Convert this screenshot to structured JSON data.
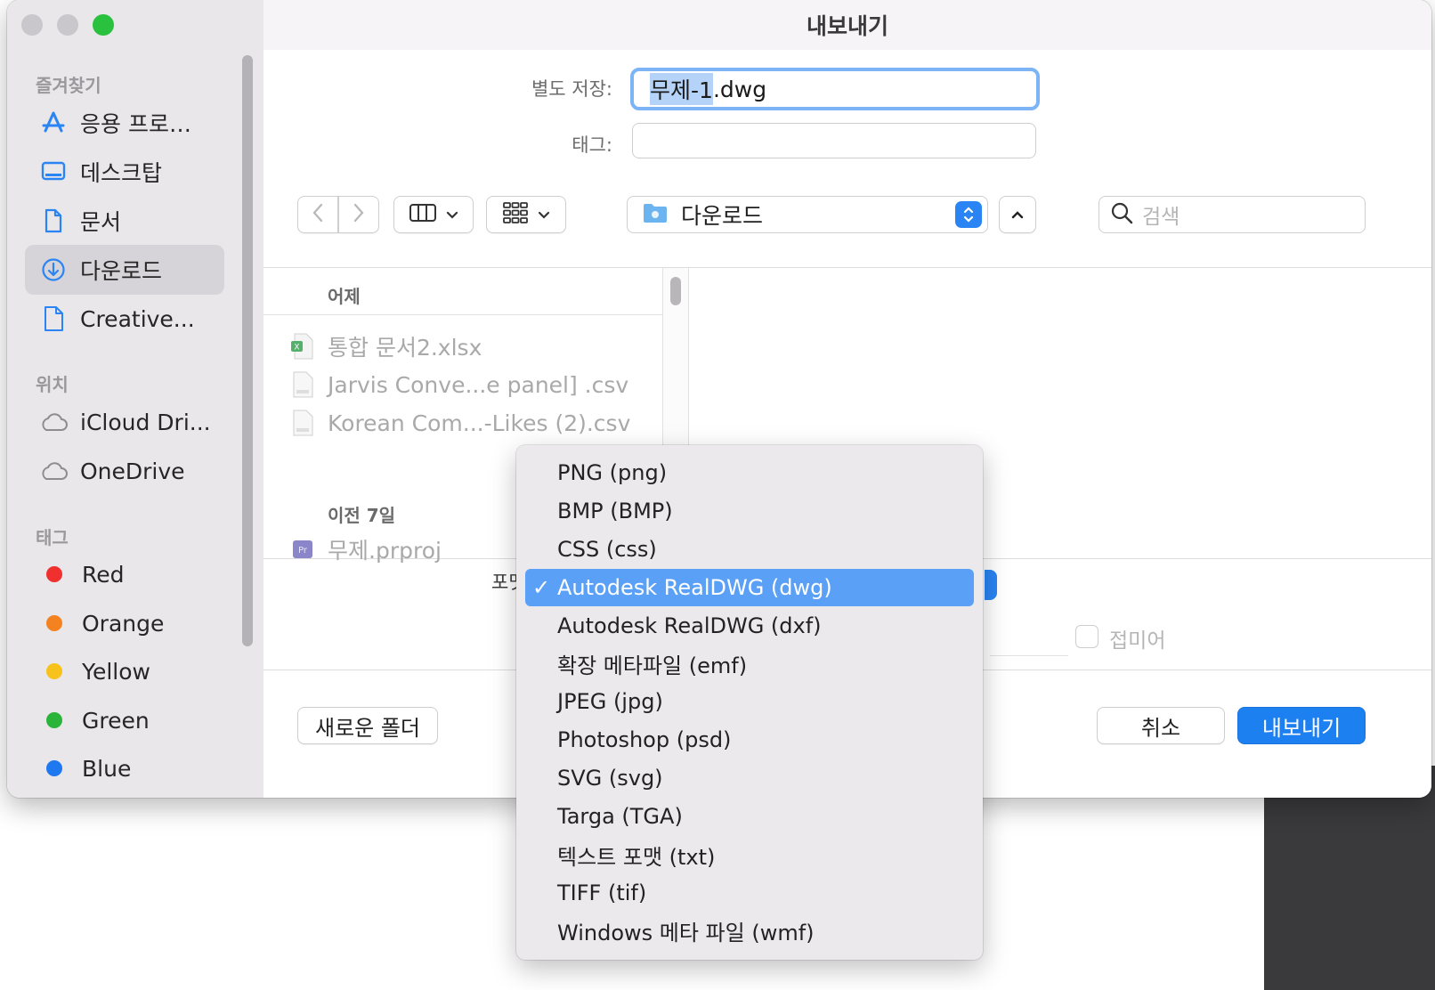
{
  "window": {
    "title": "내보내기"
  },
  "sidebar": {
    "favorites_header": "즐겨찾기",
    "favorites": [
      {
        "label": "응용 프로…",
        "icon": "app-store-icon"
      },
      {
        "label": "데스크탑",
        "icon": "desktop-icon"
      },
      {
        "label": "문서",
        "icon": "document-icon"
      },
      {
        "label": "다운로드",
        "icon": "download-icon",
        "selected": true
      },
      {
        "label": "Creative...",
        "icon": "file-icon"
      }
    ],
    "locations_header": "위치",
    "locations": [
      {
        "label": "iCloud Dri...",
        "icon": "cloud-icon"
      },
      {
        "label": "OneDrive",
        "icon": "cloud-icon"
      }
    ],
    "tags_header": "태그",
    "tags": [
      {
        "label": "Red",
        "color": "#f0302e"
      },
      {
        "label": "Orange",
        "color": "#f58220"
      },
      {
        "label": "Yellow",
        "color": "#f8c21c"
      },
      {
        "label": "Green",
        "color": "#2ab53a"
      },
      {
        "label": "Blue",
        "color": "#1e78f0"
      }
    ]
  },
  "form": {
    "save_as_label": "별도 저장:",
    "filename_selected": "무제-1",
    "filename_ext": ".dwg",
    "tags_label": "태그:",
    "tags_value": ""
  },
  "toolbar": {
    "location": "다운로드",
    "search_placeholder": "검색"
  },
  "browser": {
    "group1_header": "어제",
    "group1_files": [
      {
        "name": "통합 문서2.xlsx",
        "type": "xlsx"
      },
      {
        "name": "Jarvis Conve...e panel] .csv",
        "type": "csv"
      },
      {
        "name": "Korean Com...-Likes (2).csv",
        "type": "csv"
      }
    ],
    "group2_header": "이전 7일",
    "group2_files": [
      {
        "name": "무제.prproj",
        "type": "prproj"
      }
    ]
  },
  "options": {
    "format_label": "포맷:",
    "hide_extension_label": "접미어"
  },
  "buttons": {
    "new_folder": "새로운 폴더",
    "cancel": "취소",
    "export": "내보내기"
  },
  "format_menu": {
    "items": [
      "PNG (png)",
      "BMP (BMP)",
      "CSS (css)",
      "Autodesk RealDWG (dwg)",
      "Autodesk RealDWG (dxf)",
      "확장 메타파일 (emf)",
      "JPEG (jpg)",
      "Photoshop (psd)",
      "SVG (svg)",
      "Targa (TGA)",
      "텍스트 포맷 (txt)",
      "TIFF (tif)",
      "Windows 메타 파일 (wmf)"
    ],
    "selected_index": 3,
    "check_mark": "✓"
  },
  "colors": {
    "accent": "#1d80f1",
    "menu_highlight": "#5aa0f7",
    "sidebar_bg": "#e9e7ea"
  }
}
